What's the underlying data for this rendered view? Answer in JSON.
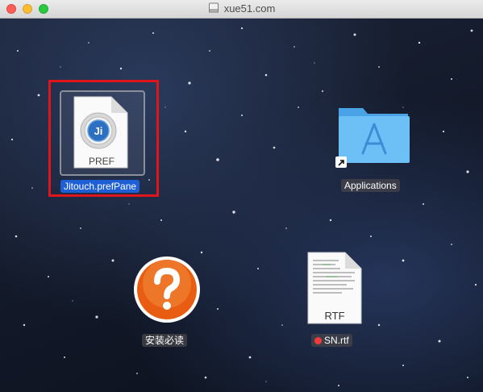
{
  "window": {
    "title": "xue51.com"
  },
  "desktop_items": [
    {
      "label": "Jitouch.prefPane",
      "icon": "preference-pane-icon",
      "badge_text": "PREF",
      "app_glyph": "Ji",
      "selected": true
    },
    {
      "label": "Applications",
      "icon": "applications-folder-alias-icon"
    },
    {
      "label": "安装必读",
      "icon": "help-question-icon"
    },
    {
      "label": "SN.rtf",
      "icon": "rtf-document-icon",
      "badge_text": "RTF",
      "tag_color": "red"
    }
  ],
  "colors": {
    "selection_label": "#1f5fd6",
    "highlight_frame": "#e0141b",
    "folder_blue": "#5ab4f0",
    "help_orange": "#f0701a",
    "tag_red": "#f33b3b"
  }
}
